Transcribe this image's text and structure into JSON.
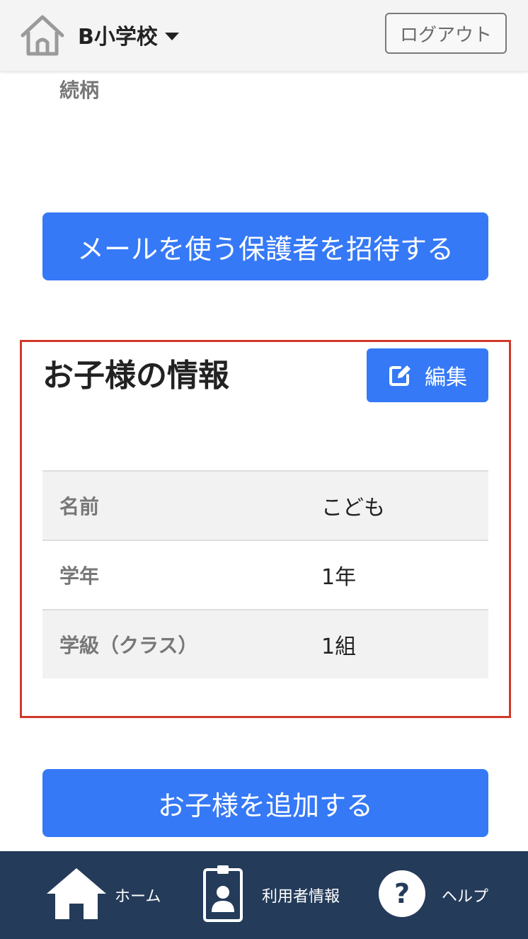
{
  "header": {
    "school_name": "B小学校",
    "logout_label": "ログアウト"
  },
  "partial_text": "続柄",
  "invite_button_label": "メールを使う保護者を招待する",
  "children_section": {
    "title": "お子様の情報",
    "edit_label": "編集",
    "rows": [
      {
        "label": "名前",
        "value": "こども"
      },
      {
        "label": "学年",
        "value": "1年"
      },
      {
        "label": "学級（クラス）",
        "value": "1組"
      }
    ]
  },
  "add_child_button_label": "お子様を追加する",
  "bottom_nav": {
    "items": [
      {
        "label": "ホーム",
        "icon": "home-icon"
      },
      {
        "label": "利用者情報",
        "icon": "id-badge-icon"
      },
      {
        "label": "ヘルプ",
        "icon": "help-icon"
      }
    ]
  },
  "colors": {
    "primary": "#3579f6",
    "nav_background": "#243b5a",
    "highlight": "#d0392b",
    "header_background": "#f4f4f4"
  }
}
